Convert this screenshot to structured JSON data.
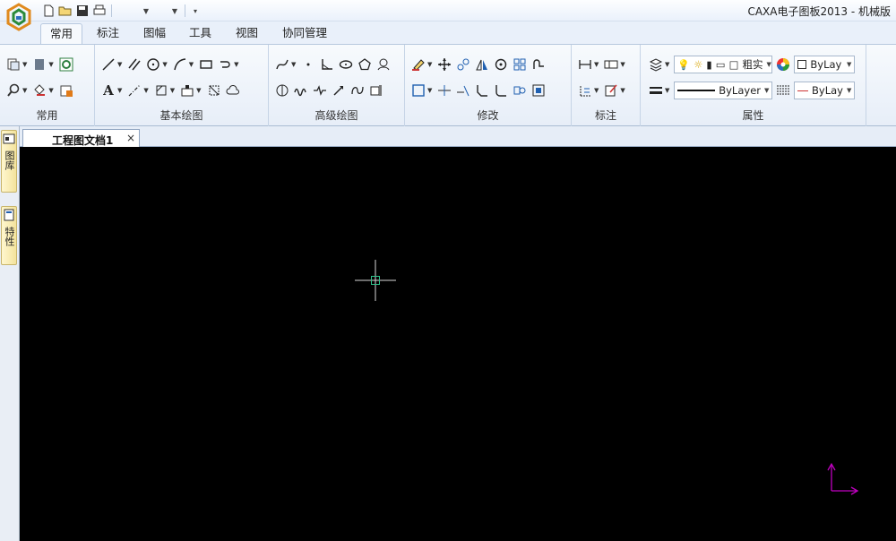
{
  "window": {
    "title": "CAXA电子图板2013 - 机械版"
  },
  "quick_access": {
    "icons": [
      "new-icon",
      "open-icon",
      "save-icon",
      "print-icon",
      "undo-dropdown",
      "redo-dropdown",
      "customize-icon"
    ]
  },
  "tabs": [
    {
      "label": "常用",
      "active": true
    },
    {
      "label": "标注"
    },
    {
      "label": "图幅"
    },
    {
      "label": "工具"
    },
    {
      "label": "视图"
    },
    {
      "label": "协同管理"
    }
  ],
  "groups": {
    "common": "常用",
    "basic_draw": "基本绘图",
    "advanced_draw": "高级绘图",
    "modify": "修改",
    "annotate": "标注",
    "properties": "属性"
  },
  "properties": {
    "linetype_label": "粗实",
    "color_combo": "ByLay",
    "line_combo": "ByLayer",
    "linewidth_combo": "ByLay"
  },
  "document": {
    "tab_label": "工程图文档1",
    "close": "×"
  },
  "sidebar": {
    "tab1": "图库",
    "tab2": "特性"
  },
  "colors": {
    "canvas": "#000000",
    "cursor": "#d8d8d8",
    "cursor_box": "#2fc08a",
    "ucs": "#c000c0",
    "accent": "#1f5fb0"
  }
}
